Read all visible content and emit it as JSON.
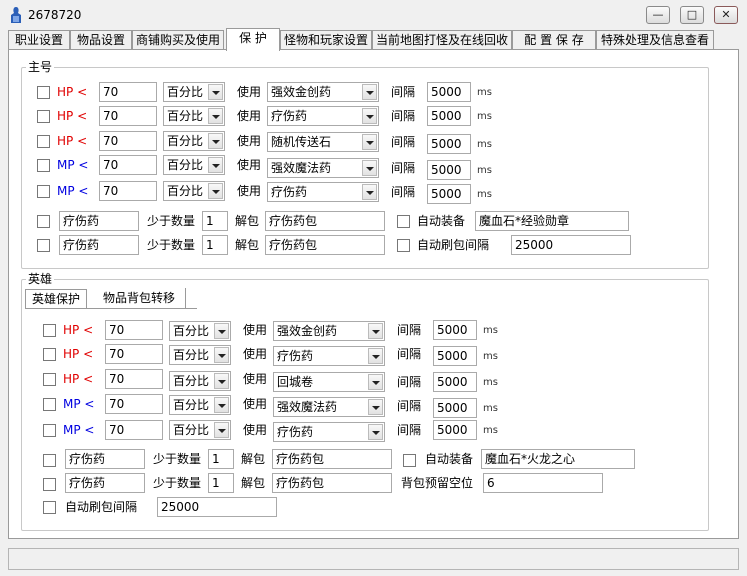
{
  "window": {
    "title": "2678720",
    "min_glyph": "—",
    "max_glyph": "□",
    "close_glyph": "✕"
  },
  "tabs": [
    "职业设置",
    "物品设置",
    "商铺购买及使用",
    "保 护",
    "怪物和玩家设置",
    "当前地图打怪及在线回收",
    "配 置 保 存",
    "特殊处理及信息查看"
  ],
  "active_tab": "保 护",
  "common": {
    "use": "使用",
    "interval": "间隔",
    "ms": "ms",
    "percent": "百分比",
    "min_qty": "少于数量",
    "unpack": "解包"
  },
  "main": {
    "title": "主号",
    "rows": [
      {
        "stat": "HP <",
        "value": "70",
        "unit": "百分比",
        "item": "强效金创药",
        "interval": "5000"
      },
      {
        "stat": "HP <",
        "value": "70",
        "unit": "百分比",
        "item": "疗伤药",
        "interval": "5000"
      },
      {
        "stat": "HP <",
        "value": "70",
        "unit": "百分比",
        "item": "随机传送石",
        "interval": "5000"
      },
      {
        "stat": "MP <",
        "value": "70",
        "unit": "百分比",
        "item": "强效魔法药",
        "interval": "5000"
      },
      {
        "stat": "MP <",
        "value": "70",
        "unit": "百分比",
        "item": "疗伤药",
        "interval": "5000"
      }
    ],
    "pack1": {
      "item": "疗伤药",
      "qty": "1",
      "pack": "疗伤药包",
      "extra_label": "自动装备",
      "extra_value": "魔血石*经验勋章"
    },
    "pack2": {
      "item": "疗伤药",
      "qty": "1",
      "pack": "疗伤药包",
      "extra_label": "自动刷包间隔",
      "extra_value": "25000"
    }
  },
  "hero": {
    "title": "英雄",
    "subtabs": [
      "英雄保护",
      "物品背包转移"
    ],
    "rows": [
      {
        "stat": "HP <",
        "value": "70",
        "unit": "百分比",
        "item": "强效金创药",
        "interval": "5000"
      },
      {
        "stat": "HP <",
        "value": "70",
        "unit": "百分比",
        "item": "疗伤药",
        "interval": "5000"
      },
      {
        "stat": "HP <",
        "value": "70",
        "unit": "百分比",
        "item": "回城卷",
        "interval": "5000"
      },
      {
        "stat": "MP <",
        "value": "70",
        "unit": "百分比",
        "item": "强效魔法药",
        "interval": "5000"
      },
      {
        "stat": "MP <",
        "value": "70",
        "unit": "百分比",
        "item": "疗伤药",
        "interval": "5000"
      }
    ],
    "pack1": {
      "item": "疗伤药",
      "qty": "1",
      "pack": "疗伤药包",
      "extra_label": "自动装备",
      "extra_value": "魔血石*火龙之心"
    },
    "pack2": {
      "item": "疗伤药",
      "qty": "1",
      "pack": "疗伤药包",
      "extra_label": "背包预留空位",
      "extra_value": "6"
    },
    "refresh": {
      "label": "自动刷包间隔",
      "value": "25000"
    }
  },
  "colors": {
    "hp": "#e00000",
    "mp": "#0000e0"
  }
}
